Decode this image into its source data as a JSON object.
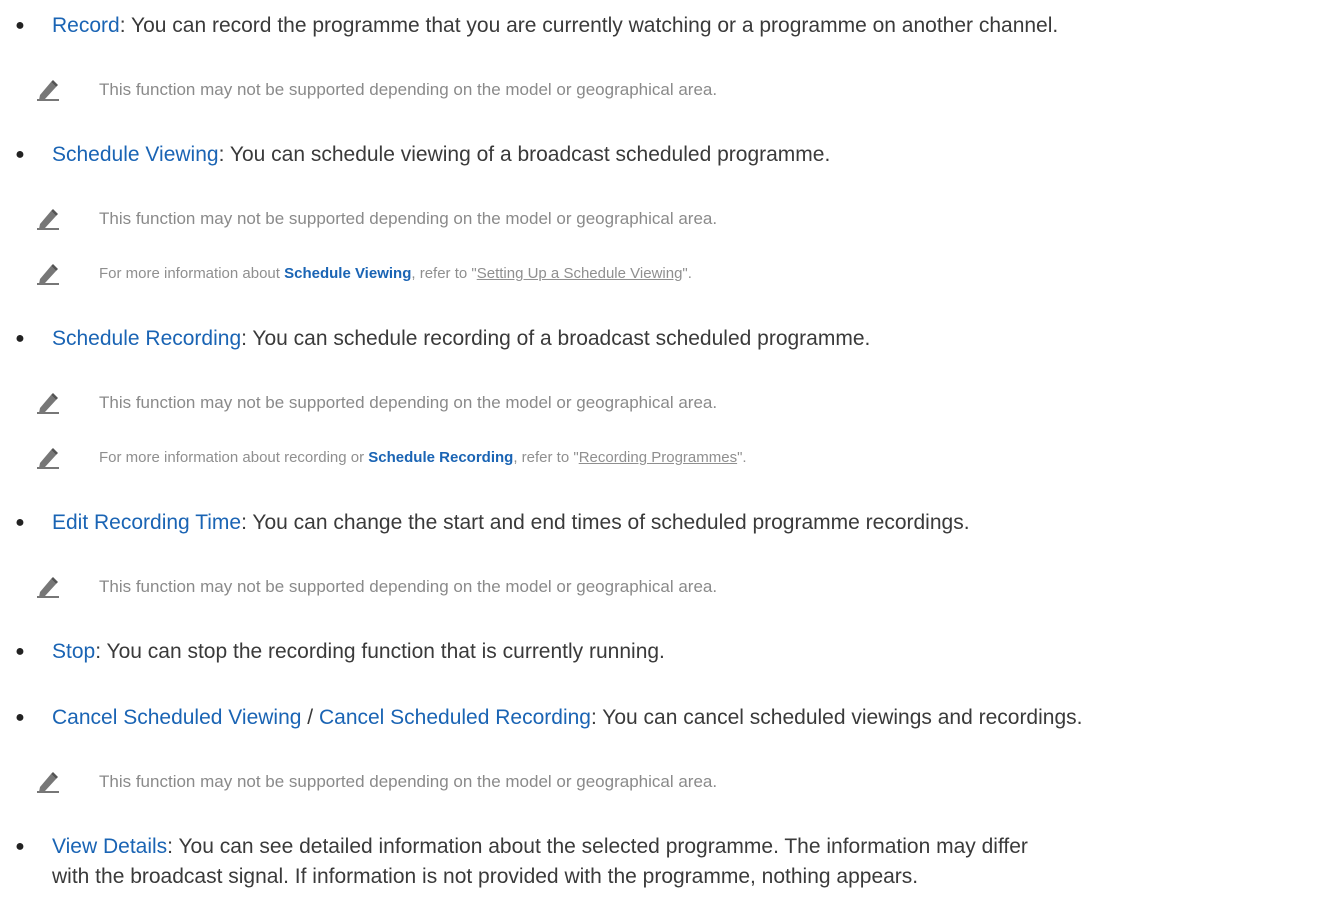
{
  "items": [
    {
      "term": "Record",
      "desc": ": You can record the programme that you are currently watching or a programme on another channel."
    },
    {
      "term": "Schedule Viewing",
      "desc": ": You can schedule viewing of a broadcast scheduled programme."
    },
    {
      "term": "Schedule Recording",
      "desc": ": You can schedule recording of a broadcast scheduled programme."
    },
    {
      "term": "Edit Recording Time",
      "desc": ": You can change the start and end times of scheduled programme recordings."
    },
    {
      "term": "Stop",
      "desc": ": You can stop the recording function that is currently running."
    },
    {
      "term": "Cancel Scheduled Viewing",
      "sep": " / ",
      "term2": "Cancel Scheduled Recording",
      "desc": ": You can cancel scheduled viewings and recordings."
    },
    {
      "term": "View Details",
      "desc_line1": ": You can see detailed information about the selected programme. The information may differ",
      "desc_line2": "with the broadcast signal. If information is not provided with the programme, nothing appears."
    }
  ],
  "notes": {
    "not_supported": "This function may not be supported depending on the model or geographical area.",
    "schedule_viewing_info": {
      "prefix": "For more information about ",
      "term": "Schedule Viewing",
      "middle": ", refer to \"",
      "link": "Setting Up a Schedule Viewing",
      "suffix": "\"."
    },
    "schedule_recording_info": {
      "prefix": "For more information about recording or ",
      "term": "Schedule Recording",
      "middle": ", refer to \"",
      "link": "Recording Programmes",
      "suffix": "\"."
    }
  },
  "icons": {
    "note": "pencil-icon",
    "bullet": "bullet-dot"
  },
  "colors": {
    "term": "#1a64b4",
    "body": "#3a3a3a",
    "note": "#8a8a8a"
  }
}
